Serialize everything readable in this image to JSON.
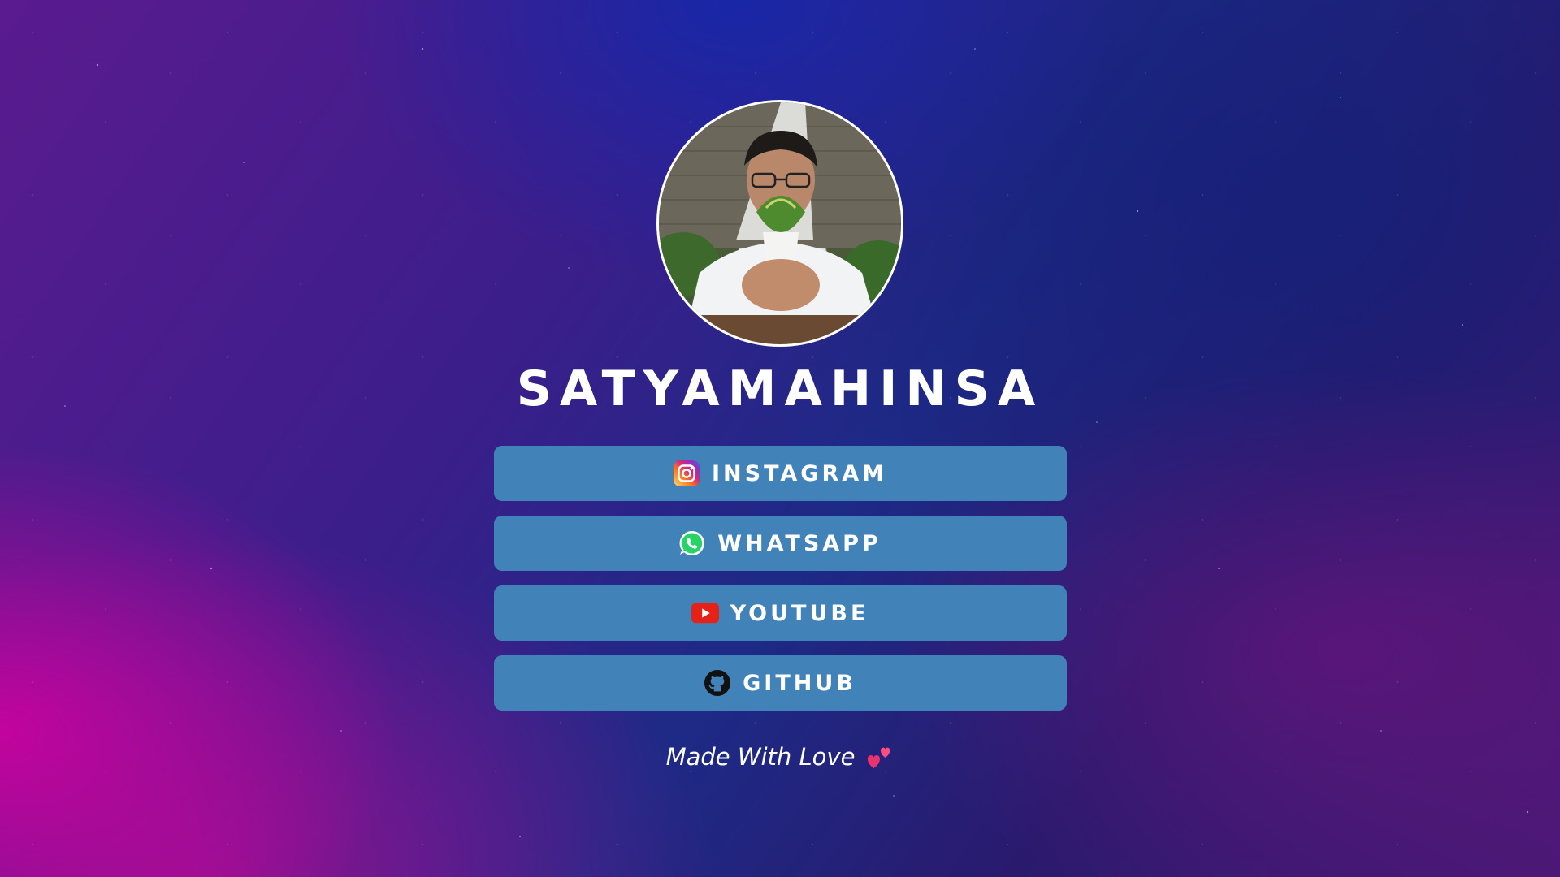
{
  "profile": {
    "name": "SATYAMAHINSA"
  },
  "links": [
    {
      "label": "INSTAGRAM",
      "icon": "instagram-icon"
    },
    {
      "label": "WHATSAPP",
      "icon": "whatsapp-icon"
    },
    {
      "label": "YOUTUBE",
      "icon": "youtube-icon"
    },
    {
      "label": "GITHUB",
      "icon": "github-icon"
    }
  ],
  "footer": {
    "text": "Made With Love",
    "icon": "two-hearts-icon"
  },
  "colors": {
    "button": "#4182b8",
    "text": "#ffffff"
  }
}
